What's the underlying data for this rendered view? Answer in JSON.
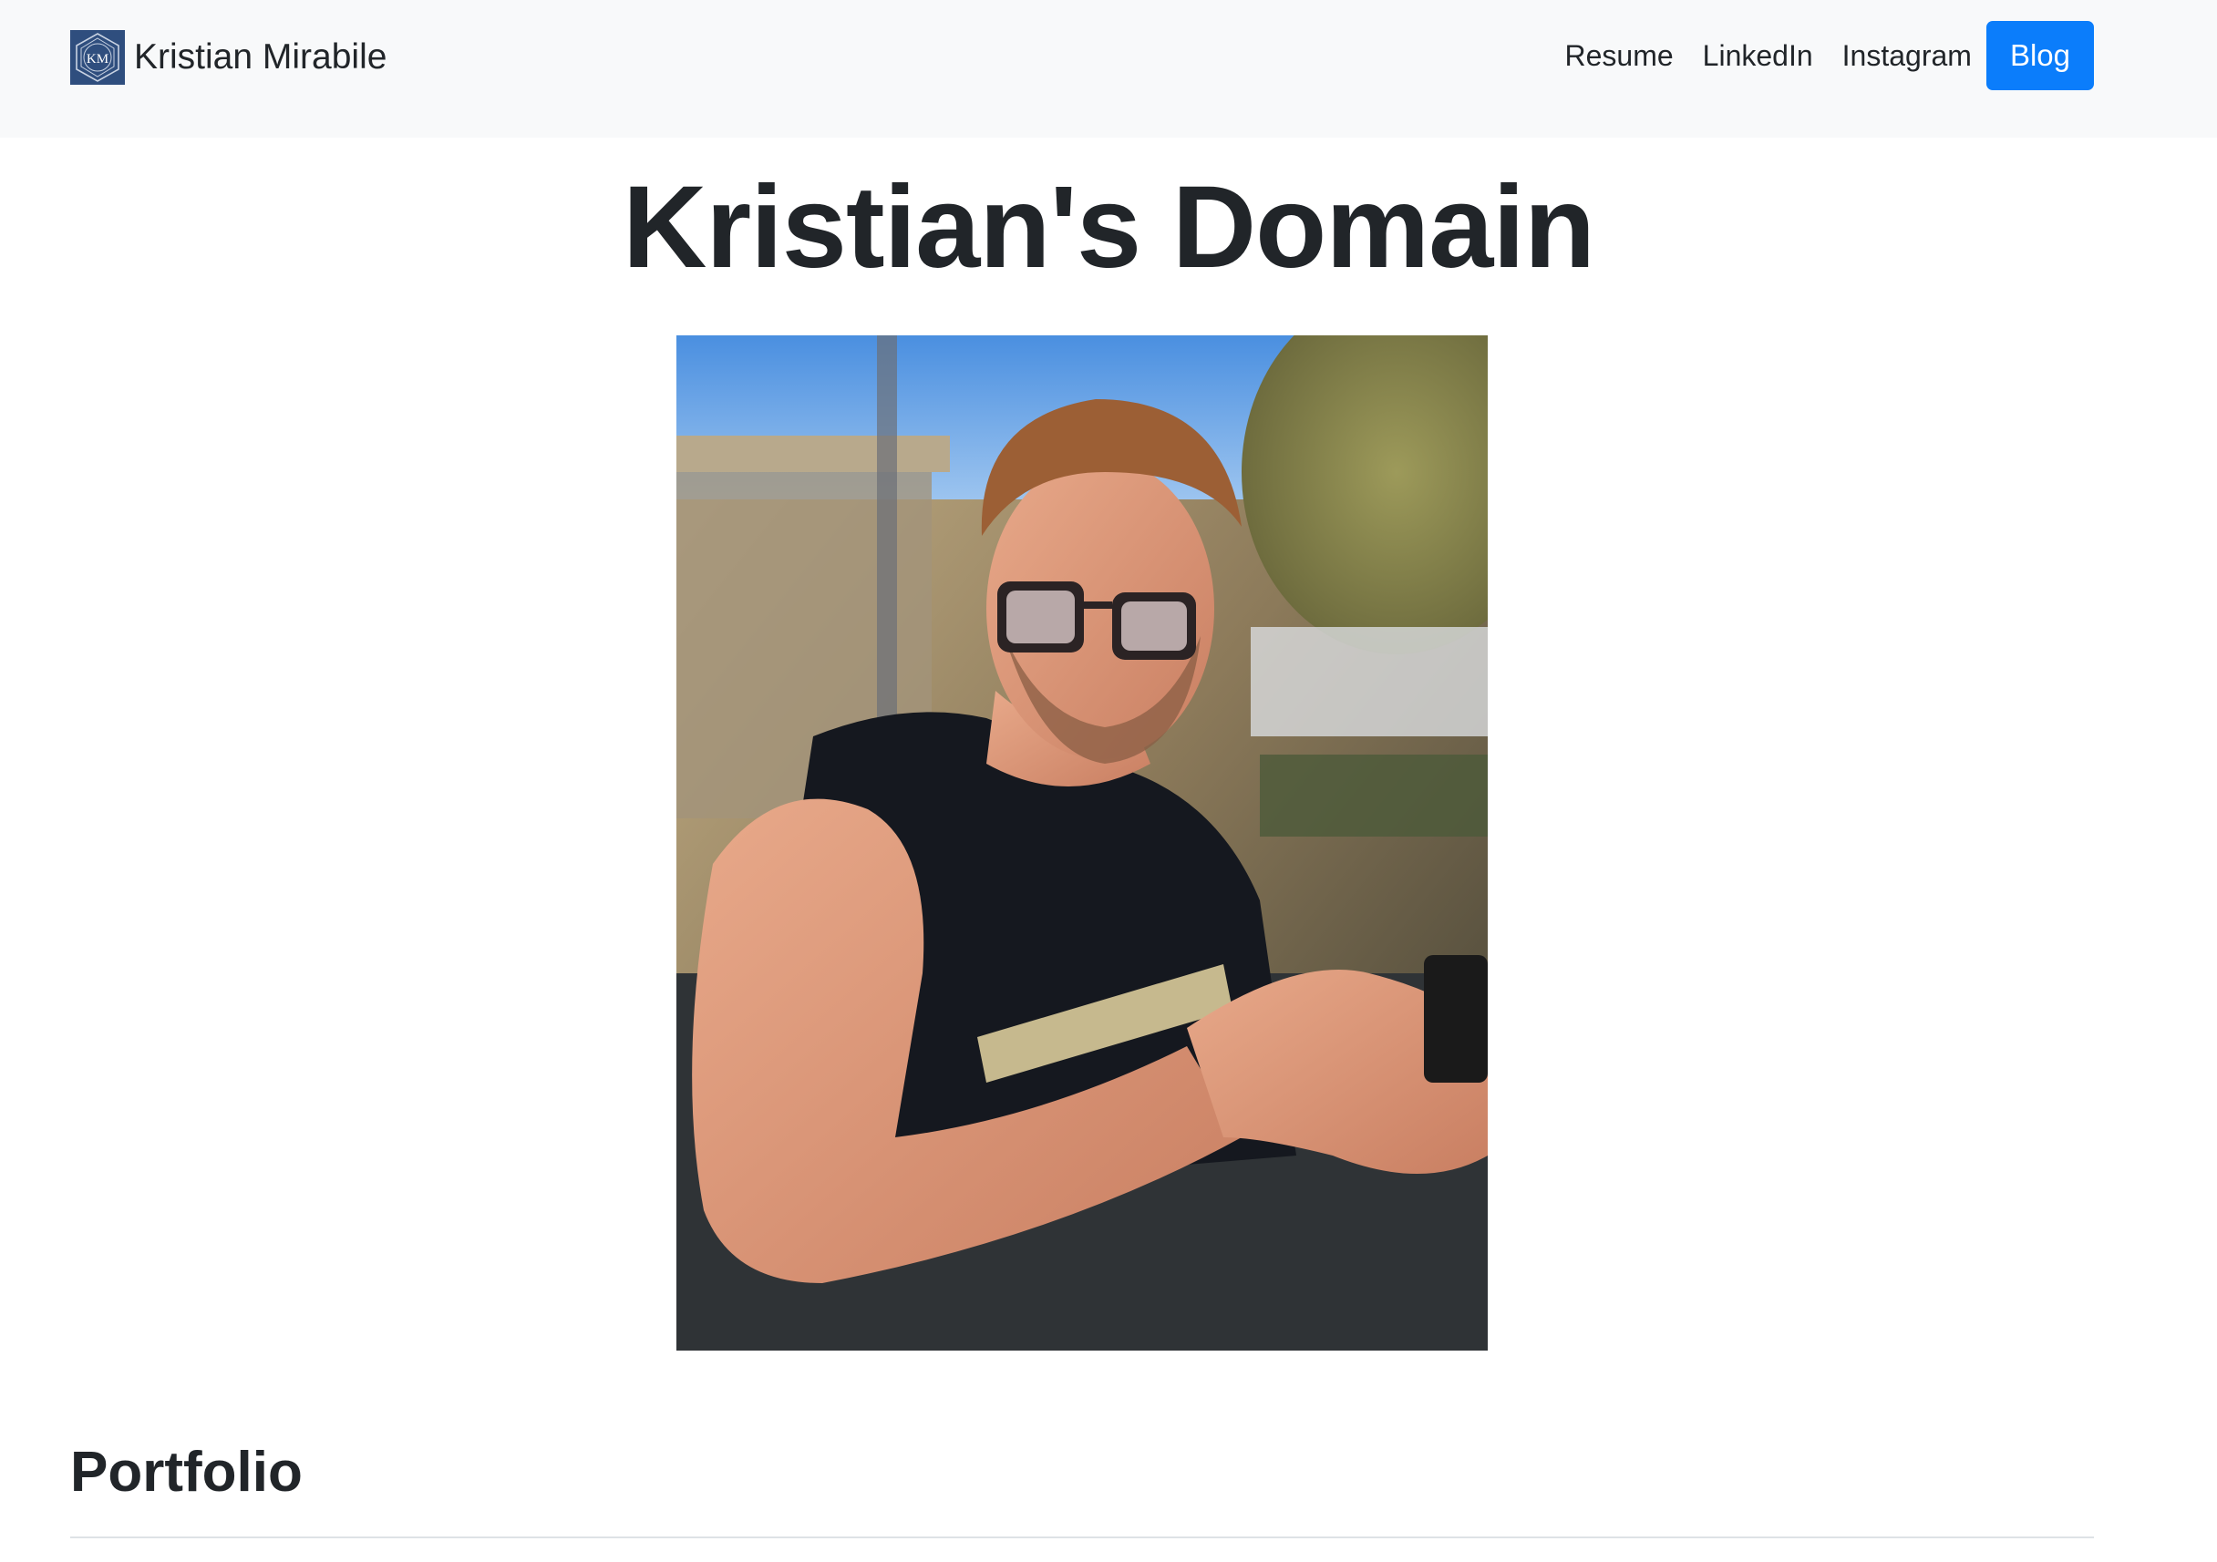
{
  "navbar": {
    "brand_name": "Kristian Mirabile",
    "brand_logo_text": "KM",
    "links": [
      {
        "label": "Resume"
      },
      {
        "label": "LinkedIn"
      },
      {
        "label": "Instagram"
      }
    ],
    "blog_label": "Blog"
  },
  "main": {
    "title": "Kristian's Domain",
    "section_title": "Portfolio"
  },
  "colors": {
    "navbar_bg": "#f8f9fa",
    "accent": "#0b7dfb",
    "text": "#212529",
    "logo_bg": "#2f4e7e"
  }
}
